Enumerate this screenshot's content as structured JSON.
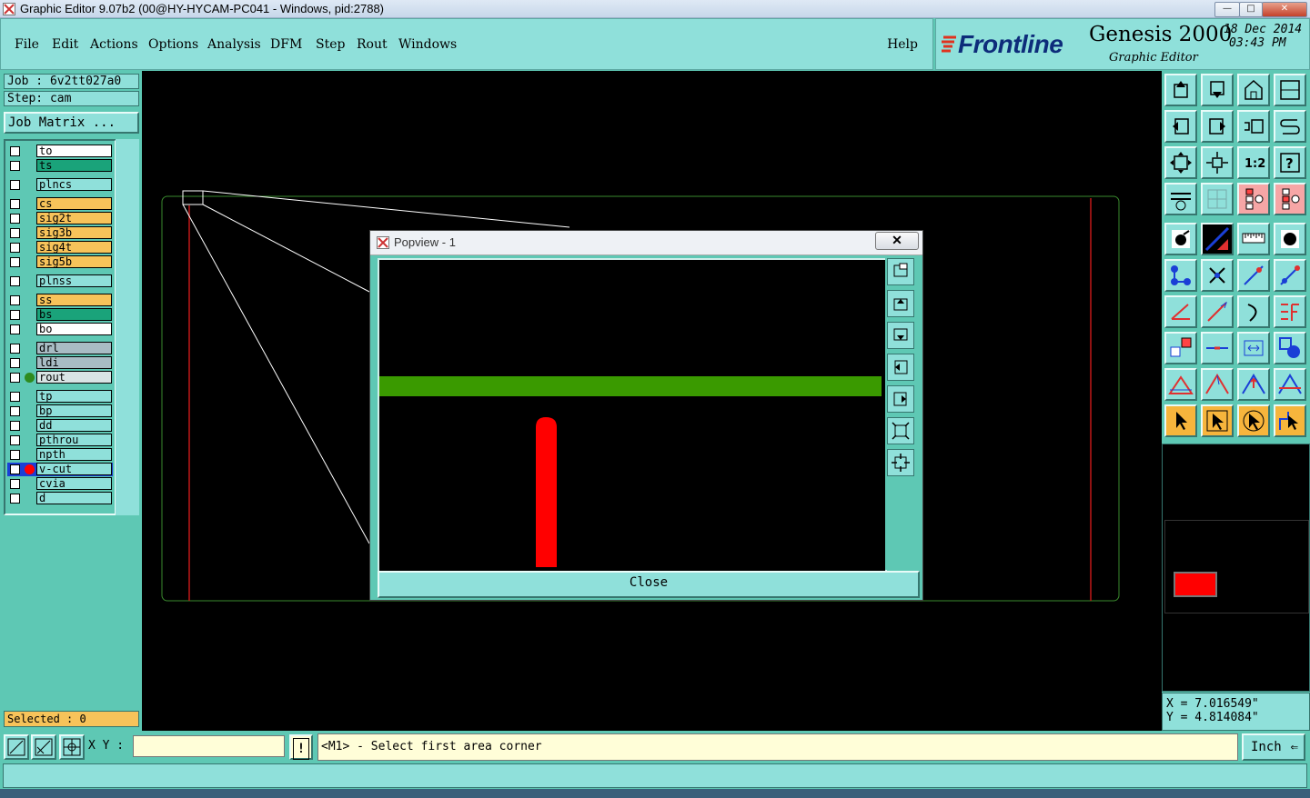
{
  "window": {
    "title": "Graphic Editor 9.07b2 (00@HY-HYCAM-PC041 - Windows, pid:2788)",
    "min": "—",
    "max": "□",
    "close": "✕"
  },
  "menu": {
    "items": [
      "File",
      "Edit",
      "Actions",
      "Options",
      "Analysis",
      "DFM",
      "Step",
      "Rout",
      "Windows"
    ],
    "help": "Help"
  },
  "brand": {
    "logo": "Frontline",
    "product": "Genesis 2000",
    "subtitle": "Graphic Editor",
    "date": "18 Dec 2014",
    "time": "03:43 PM"
  },
  "job": {
    "job_label": "Job : 6v2tt027a0",
    "step_label": "Step: cam",
    "matrix_button": "Job Matrix ..."
  },
  "layers": [
    {
      "name": "to",
      "color": "#ffffff"
    },
    {
      "name": "ts",
      "color": "#1aa37a"
    },
    {
      "name": "plncs",
      "color": "#8fe0da"
    },
    {
      "name": "cs",
      "color": "#f7c35a"
    },
    {
      "name": "sig2t",
      "color": "#f7c35a"
    },
    {
      "name": "sig3b",
      "color": "#f7c35a"
    },
    {
      "name": "sig4t",
      "color": "#f7c35a"
    },
    {
      "name": "sig5b",
      "color": "#f7c35a"
    },
    {
      "name": "plnss",
      "color": "#8fe0da"
    },
    {
      "name": "ss",
      "color": "#f7c35a"
    },
    {
      "name": "bs",
      "color": "#1aa37a"
    },
    {
      "name": "bo",
      "color": "#ffffff"
    },
    {
      "name": "drl",
      "color": "#a8bcc4"
    },
    {
      "name": "ldi",
      "color": "#a8bcc4"
    },
    {
      "name": "rout",
      "color": "#d8e4e4",
      "marker": "#2e8b1e"
    },
    {
      "name": "tp",
      "color": "#8fe0da"
    },
    {
      "name": "bp",
      "color": "#8fe0da"
    },
    {
      "name": "dd",
      "color": "#8fe0da"
    },
    {
      "name": "pthrou",
      "color": "#8fe0da"
    },
    {
      "name": "npth",
      "color": "#8fe0da"
    },
    {
      "name": "v-cut",
      "color": "#8fe0da",
      "marker": "#ff0000",
      "active": true
    },
    {
      "name": "cvia",
      "color": "#8fe0da"
    },
    {
      "name": "d",
      "color": "#8fe0da"
    }
  ],
  "selected": "Selected : 0",
  "popview": {
    "title": "Popview - 1",
    "close_x": "✕",
    "close_label": "Close"
  },
  "coords": {
    "x": "X = 7.016549\"",
    "y": "Y = 4.814084\""
  },
  "status": {
    "xy_label": "X Y :",
    "xy_value": "",
    "alert": "!",
    "message": "<M1> - Select first area corner",
    "unit": "Inch"
  },
  "toolbox_icons": [
    "move-up-icon",
    "move-down-icon",
    "home-icon",
    "window-icon",
    "pan-left-icon",
    "pan-right-icon",
    "undo-zoom-icon",
    "redraw-icon",
    "zoom-fit-icon",
    "zoom-profile-icon",
    "zoom-1-2-icon",
    "help-icon",
    "settings-icon",
    "grid-icon",
    "layers-on-icon",
    "layers-off-icon"
  ],
  "colors": {
    "panel": "#5ec8b4",
    "panel_light": "#8fe0da",
    "canvas": "#000000",
    "trace_green": "#3a9a00",
    "vcut_red": "#ff0000"
  }
}
